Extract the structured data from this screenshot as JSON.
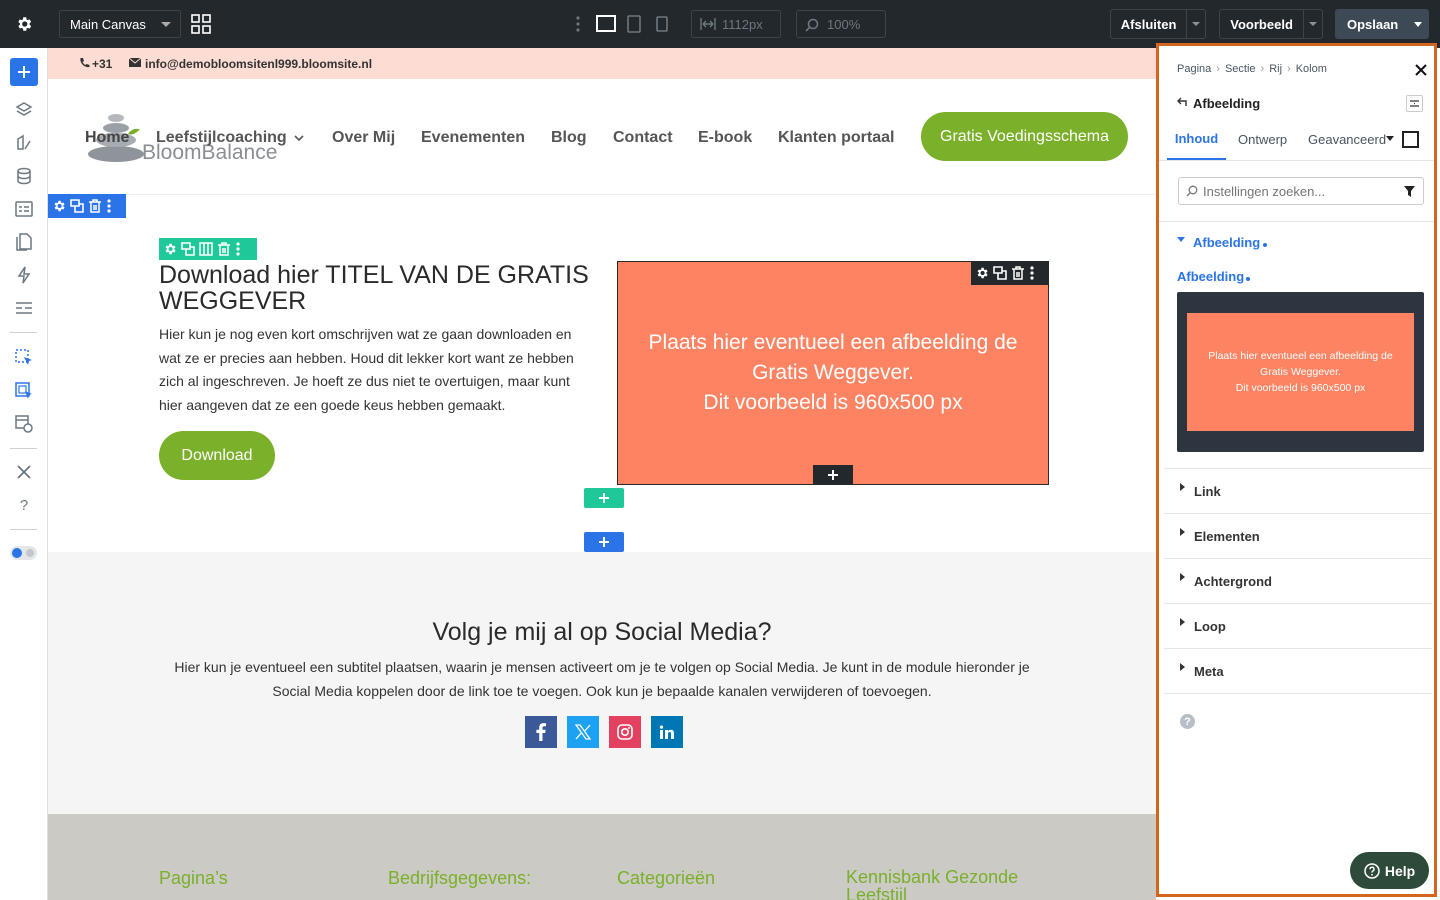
{
  "topbar": {
    "canvas_select": "Main Canvas",
    "width_value": "1112px",
    "zoom_value": "100%",
    "close_label": "Afsluiten",
    "preview_label": "Voorbeeld",
    "save_label": "Opslaan"
  },
  "colors": {
    "topbar_bg": "#23282d",
    "accent_blue": "#2b74e8",
    "accent_green": "#7ab02a",
    "teal": "#1ec899",
    "placeholder_orange": "#fd8362",
    "highlight_border": "#d3661c"
  },
  "site": {
    "topbar": {
      "phone": "+31",
      "email": "info@demobloomsitenl999.bloomsite.nl"
    },
    "logo_text": "BloomBalance",
    "nav": [
      "Home",
      "Leefstijlcoaching",
      "Over Mij",
      "Evenementen",
      "Blog",
      "Contact",
      "E-book",
      "Klanten portaal"
    ],
    "cta": "Gratis Voedingsschema",
    "hero": {
      "title": "Download hier TITEL VAN DE GRATIS WEGGEVER",
      "body": "Hier kun je nog even kort omschrijven wat ze gaan downloaden en wat ze er precies aan hebben. Houd dit lekker kort want ze hebben zich al ingeschreven. Je hoeft ze dus niet te overtuigen, maar kunt hier aangeven dat ze een goede keus hebben gemaakt.",
      "button": "Download",
      "image_line1": "Plaats hier eventueel een afbeelding de",
      "image_line2": "Gratis Weggever.",
      "image_line3": "Dit voorbeeld is 960x500 px"
    },
    "social": {
      "title": "Volg je mij al op Social Media?",
      "body": "Hier kun je eventueel een subtitel plaatsen, waarin je mensen activeert om je te volgen op Social Media. Je kunt in de module hieronder je Social Media koppelen door de link toe te voegen. Ook kun je bepaalde kanalen verwijderen of toevoegen.",
      "icons": [
        "facebook-icon",
        "x-icon",
        "instagram-icon",
        "linkedin-icon"
      ]
    },
    "footer": {
      "columns": [
        "Pagina’s",
        "Bedrijfsgegevens:",
        "Categorieën",
        "Kennisbank Gezonde Leefstijl"
      ]
    }
  },
  "panel": {
    "breadcrumb": [
      "Pagina",
      "Sectie",
      "Rij",
      "Kolom"
    ],
    "title": "Afbeelding",
    "tabs": [
      "Inhoud",
      "Ontwerp",
      "Geavanceerd"
    ],
    "search_placeholder": "Instellingen zoeken...",
    "section_open": "Afbeelding",
    "field_label": "Afbeelding",
    "preview_line1": "Plaats hier eventueel een afbeelding de",
    "preview_line2": "Gratis Weggever.",
    "preview_line3": "Dit voorbeeld is 960x500 px",
    "sections": [
      "Link",
      "Elementen",
      "Achtergrond",
      "Loop",
      "Meta"
    ],
    "help": "Help"
  }
}
